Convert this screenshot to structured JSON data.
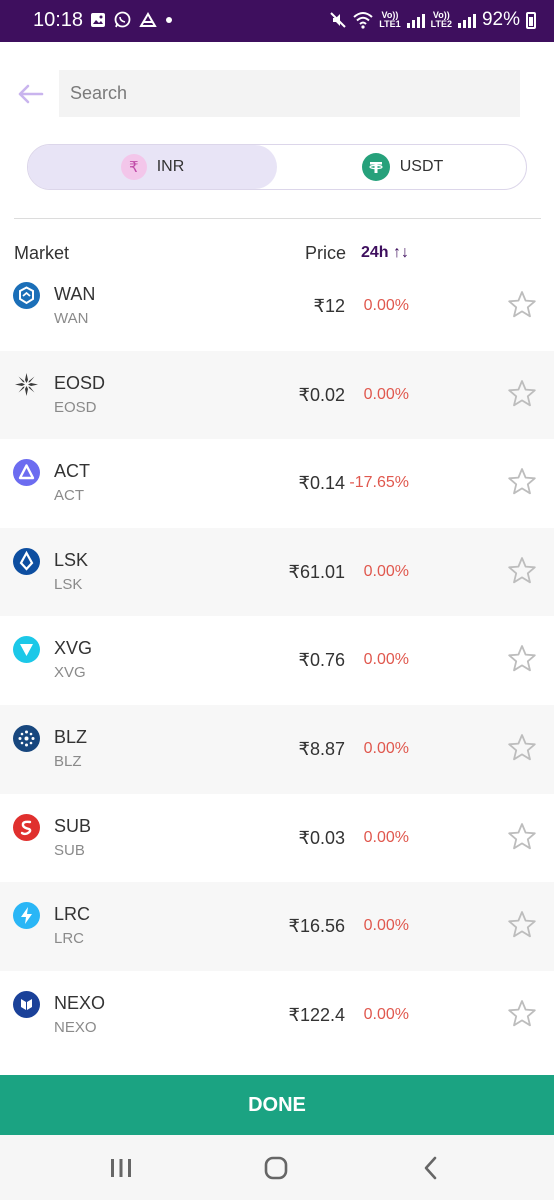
{
  "status_bar": {
    "time": "10:18",
    "lte1": "Vo)) LTE1",
    "lte2": "Vo)) LTE2",
    "battery": "92%",
    "left_icons": [
      "gallery-icon",
      "whatsapp-icon",
      "app-icon",
      "dot-icon"
    ],
    "right_icons": [
      "mute-icon",
      "wifi-icon",
      "signal-icon",
      "battery-icon"
    ]
  },
  "search": {
    "placeholder": "Search",
    "value": ""
  },
  "currency_toggle": {
    "inr": {
      "label": "INR",
      "symbol": "₹",
      "selected": true
    },
    "usdt": {
      "label": "USDT",
      "selected": false
    }
  },
  "table_header": {
    "market": "Market",
    "price": "Price",
    "change": "24h ↑↓"
  },
  "coins": [
    {
      "name": "WAN",
      "symbol": "WAN",
      "price": "₹12",
      "change": "0.00%",
      "icon": "wan-icon",
      "color": "#1b6fb8"
    },
    {
      "name": "EOSD",
      "symbol": "EOSD",
      "price": "₹0.02",
      "change": "0.00%",
      "icon": "eosd-icon",
      "color": "#3a3a3a"
    },
    {
      "name": "ACT",
      "symbol": "ACT",
      "price": "₹0.14",
      "change": "-17.65%",
      "icon": "act-icon",
      "color": "#6c6cf0"
    },
    {
      "name": "LSK",
      "symbol": "LSK",
      "price": "₹61.01",
      "change": "0.00%",
      "icon": "lsk-icon",
      "color": "#0d4ea0"
    },
    {
      "name": "XVG",
      "symbol": "XVG",
      "price": "₹0.76",
      "change": "0.00%",
      "icon": "xvg-icon",
      "color": "#1cc8e8"
    },
    {
      "name": "BLZ",
      "symbol": "BLZ",
      "price": "₹8.87",
      "change": "0.00%",
      "icon": "blz-icon",
      "color": "#18477e"
    },
    {
      "name": "SUB",
      "symbol": "SUB",
      "price": "₹0.03",
      "change": "0.00%",
      "icon": "sub-icon",
      "color": "#e0302e"
    },
    {
      "name": "LRC",
      "symbol": "LRC",
      "price": "₹16.56",
      "change": "0.00%",
      "icon": "lrc-icon",
      "color": "#2ab6f6"
    },
    {
      "name": "NEXO",
      "symbol": "NEXO",
      "price": "₹122.4",
      "change": "0.00%",
      "icon": "nexo-icon",
      "color": "#1a4199"
    }
  ],
  "done_button": {
    "label": "DONE"
  },
  "nav_bar": {
    "icons": [
      "recent-apps-icon",
      "home-icon",
      "back-nav-icon"
    ]
  },
  "colors": {
    "status_bar": "#3e0f5e",
    "accent": "#3e0f5e",
    "done": "#1ba382",
    "change_red": "#e0584e",
    "selected_toggle": "#e8e4f6"
  }
}
